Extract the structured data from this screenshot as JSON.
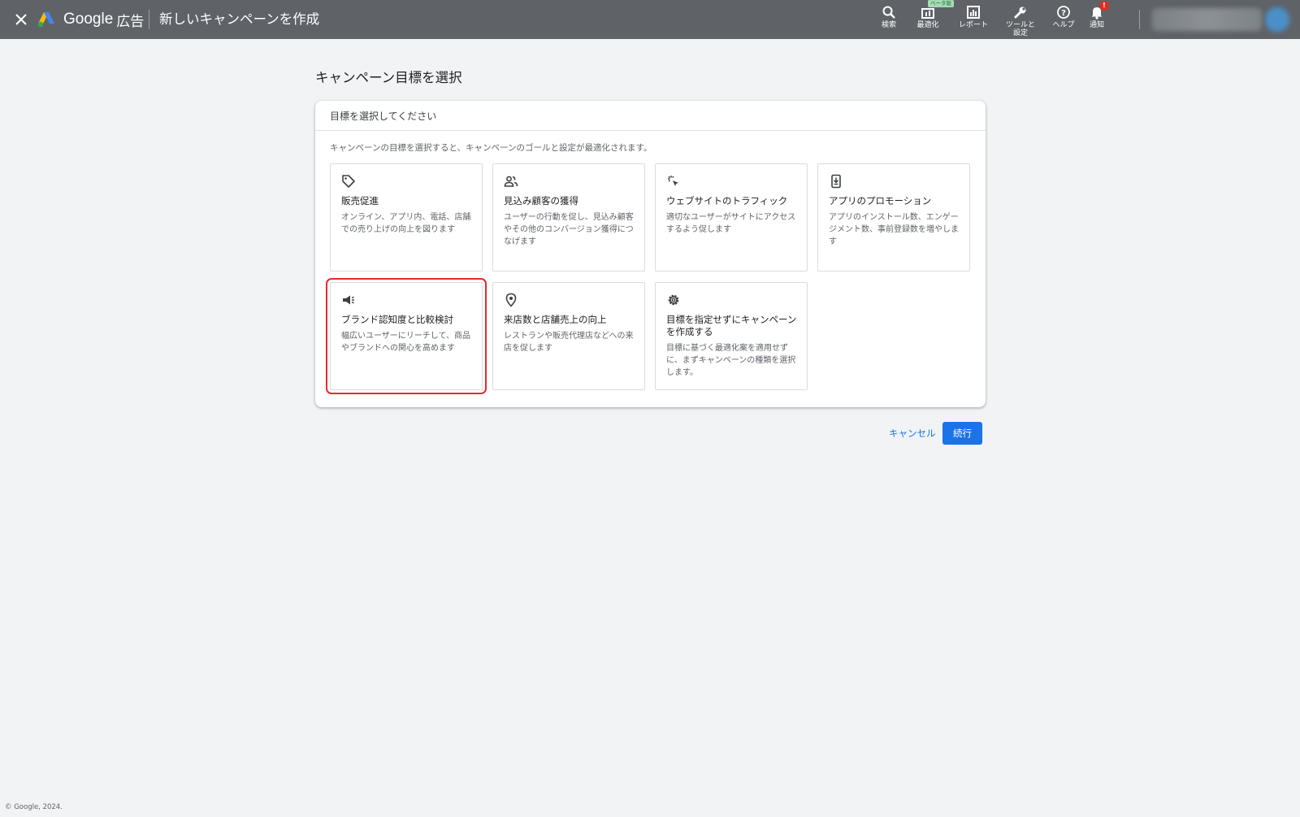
{
  "header": {
    "brand_google": "Google",
    "brand_ads": "広告",
    "page_title": "新しいキャンペーンを作成",
    "tools": [
      {
        "label": "検索",
        "icon": "search-icon"
      },
      {
        "label": "最適化",
        "icon": "insights-icon",
        "badge": "ベータ版"
      },
      {
        "label": "レポート",
        "icon": "report-icon"
      },
      {
        "label_line1": "ツールと",
        "label_line2": "設定",
        "icon": "wrench-icon"
      },
      {
        "label": "ヘルプ",
        "icon": "help-icon"
      },
      {
        "label": "通知",
        "icon": "bell-icon",
        "badge": "!"
      }
    ]
  },
  "main": {
    "title": "キャンペーン目標を選択",
    "panel_heading": "目標を選択してください",
    "panel_description": "キャンペーンの目標を選択すると、キャンペーンのゴールと設定が最適化されます。",
    "goals": [
      {
        "title": "販売促進",
        "description": "オンライン、アプリ内、電話、店舗での売り上げの向上を図ります",
        "icon": "tag-icon"
      },
      {
        "title": "見込み顧客の獲得",
        "description": "ユーザーの行動を促し、見込み顧客やその他のコンバージョン獲得につなげます",
        "icon": "people-icon"
      },
      {
        "title": "ウェブサイトのトラフィック",
        "description": "適切なユーザーがサイトにアクセスするよう促します",
        "icon": "click-icon"
      },
      {
        "title": "アプリのプロモーション",
        "description": "アプリのインストール数、エンゲージメント数、事前登録数を増やします",
        "icon": "phone-download-icon"
      },
      {
        "title": "ブランド認知度と比較検討",
        "description": "幅広いユーザーにリーチして、商品やブランドへの関心を高めます",
        "icon": "megaphone-icon"
      },
      {
        "title": "来店数と店舗売上の向上",
        "description": "レストランや販売代理店などへの来店を促します",
        "icon": "location-pin-icon"
      },
      {
        "title": "目標を指定せずにキャンペーンを作成する",
        "description": "目標に基づく最適化案を適用せずに、まずキャンペーンの種類を選択します。",
        "icon": "gear-icon"
      }
    ]
  },
  "actions": {
    "cancel": "キャンセル",
    "continue": "続行"
  },
  "footer": {
    "copyright": "© Google, 2024."
  },
  "colors": {
    "topbar": "#5f6368",
    "accent": "#1a73e8",
    "highlight": "#e52b2b",
    "background": "#f1f3f4"
  }
}
